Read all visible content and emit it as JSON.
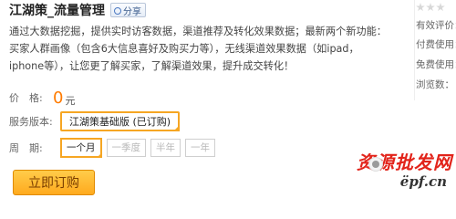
{
  "header": {
    "title": "江湖策_流量管理",
    "share_label": "分享"
  },
  "description": "通过大数据挖掘，提供实时访客数据，渠道推荐及转化效果数据；最新两个新功能：买家人群画像（包含6大信息喜好及购买力等），无线渠道效果数据（如ipad，iphone等），让您更了解买家，了解渠道效果，提升成交转化！",
  "price": {
    "label": "价　格:",
    "value": "0",
    "unit": "元"
  },
  "version": {
    "label": "服务版本:",
    "selected": "江湖策基础版 (已订购)"
  },
  "period": {
    "label": "周　期:",
    "options": [
      {
        "label": "一个月",
        "active": true
      },
      {
        "label": "一季度",
        "active": false
      },
      {
        "label": "半年",
        "active": false
      },
      {
        "label": "一年",
        "active": false
      }
    ]
  },
  "buy_button": "立即订购",
  "sidebar": {
    "items": [
      "有效评价：",
      "付费使用：",
      "免费使用：",
      "浏览数："
    ]
  },
  "watermark": {
    "text": "资源批发网",
    "domain": "ëpf.cn"
  },
  "colors": {
    "accent": "#ff7b00",
    "selected_border": "#f6a623",
    "button_bg": "#ffb42e"
  }
}
